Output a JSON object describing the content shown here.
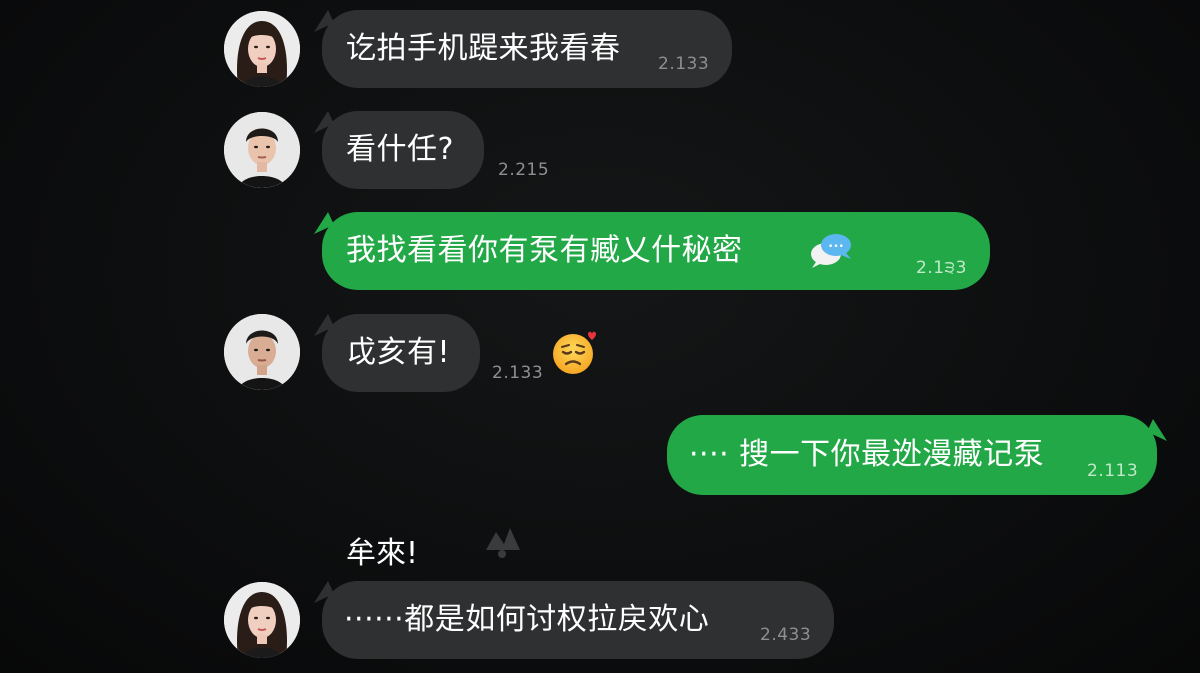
{
  "messages": [
    {
      "text": "讫拍手机踶来我看春",
      "time": "2.133"
    },
    {
      "text": "看什任?",
      "time": "2.215"
    },
    {
      "text": "我找看看你有泵有臧乂什秘密",
      "time": "2.1੩3"
    },
    {
      "text": "戉亥有!",
      "time": "2.133"
    },
    {
      "text": "···· 搜一下你最迯漫藏记泵",
      "time": "2.113"
    },
    {
      "text": "牟來!"
    },
    {
      "text": "······都是如何讨权拉戻欢心",
      "time": "2.433"
    }
  ],
  "icons": {
    "emoji": "tired-face-emoji-icon",
    "chat_bubbles": "chat-bubbles-icon",
    "faded_mark": "faded-mark-icon"
  },
  "colors": {
    "background": "#0a0b0c",
    "gray_bubble": "#2f3032",
    "green_bubble": "#23a847",
    "timestamp": "#8d8f92"
  }
}
